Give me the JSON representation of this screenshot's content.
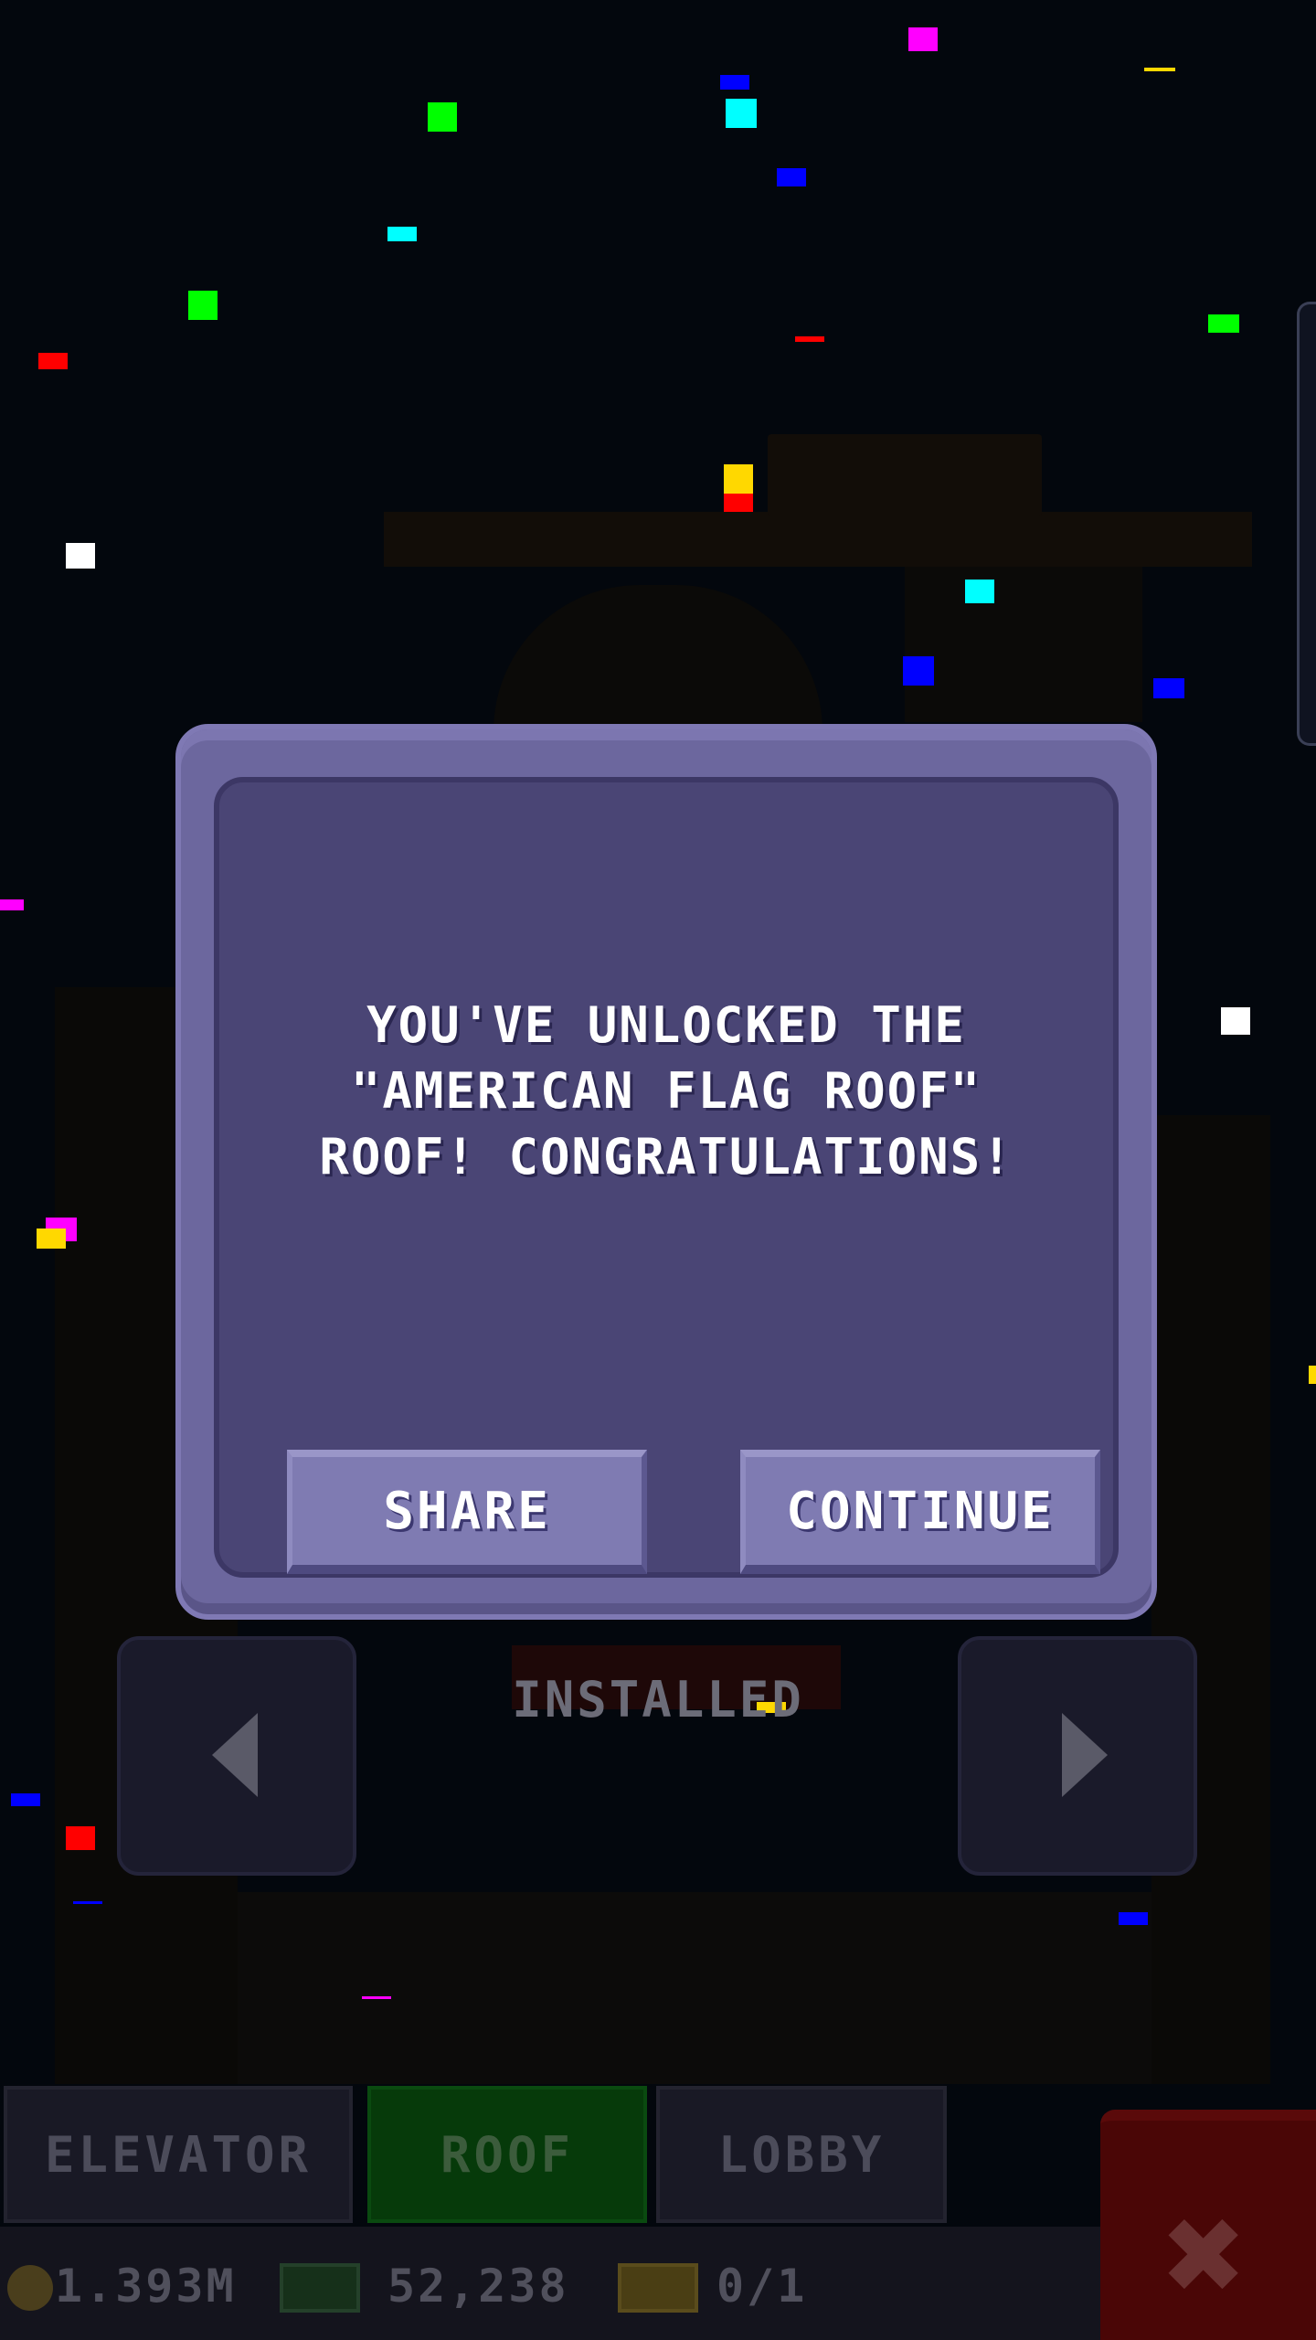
{
  "dialog": {
    "message": "YOU'VE UNLOCKED THE \"AMERICAN FLAG ROOF\" ROOF! CONGRATULATIONS!",
    "share_label": "SHARE",
    "continue_label": "CONTINUE"
  },
  "selector": {
    "status_label": "INSTALLED"
  },
  "tabs": {
    "elevator": "ELEVATOR",
    "roof": "ROOF",
    "lobby": "LOBBY",
    "active": "roof"
  },
  "status": {
    "coins": "1.393M",
    "cash": "52,238",
    "tickets": "0/1"
  },
  "icons": {
    "prev": "arrow-left-icon",
    "next": "arrow-right-icon",
    "close": "close-icon",
    "coin": "coin-icon",
    "cash": "cash-icon",
    "ticket": "ticket-icon"
  },
  "colors": {
    "dialog_outer": "#6c679e",
    "dialog_inner": "#4a4575",
    "button": "#7f7bb2",
    "active_tab": "#063a0a",
    "close_button": "#4a0606"
  }
}
